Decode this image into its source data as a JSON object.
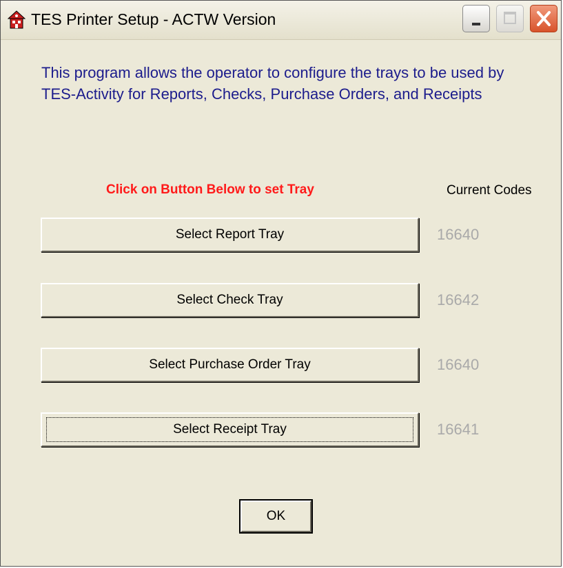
{
  "window": {
    "title": "TES Printer Setup  - ACTW Version",
    "controls": {
      "minimize_icon": "minimize-icon",
      "maximize_icon": "maximize-icon",
      "close_icon": "close-icon"
    }
  },
  "description": "This program allows the operator to configure the trays to be used by TES-Activity for Reports, Checks, Purchase Orders, and Receipts",
  "instruction": "Click on Button Below to set Tray",
  "codes_header": "Current Codes",
  "trays": [
    {
      "label": "Select Report Tray",
      "code": "16640"
    },
    {
      "label": "Select Check Tray",
      "code": "16642"
    },
    {
      "label": "Select Purchase Order Tray",
      "code": "16640"
    },
    {
      "label": "Select Receipt Tray",
      "code": "16641"
    }
  ],
  "ok_label": "OK",
  "colors": {
    "description": "#1c1c8c",
    "instruction": "#ff1a1a",
    "code_disabled": "#a9a9a9",
    "dialog_bg": "#ece9d8",
    "close_button": "#d8532b"
  }
}
